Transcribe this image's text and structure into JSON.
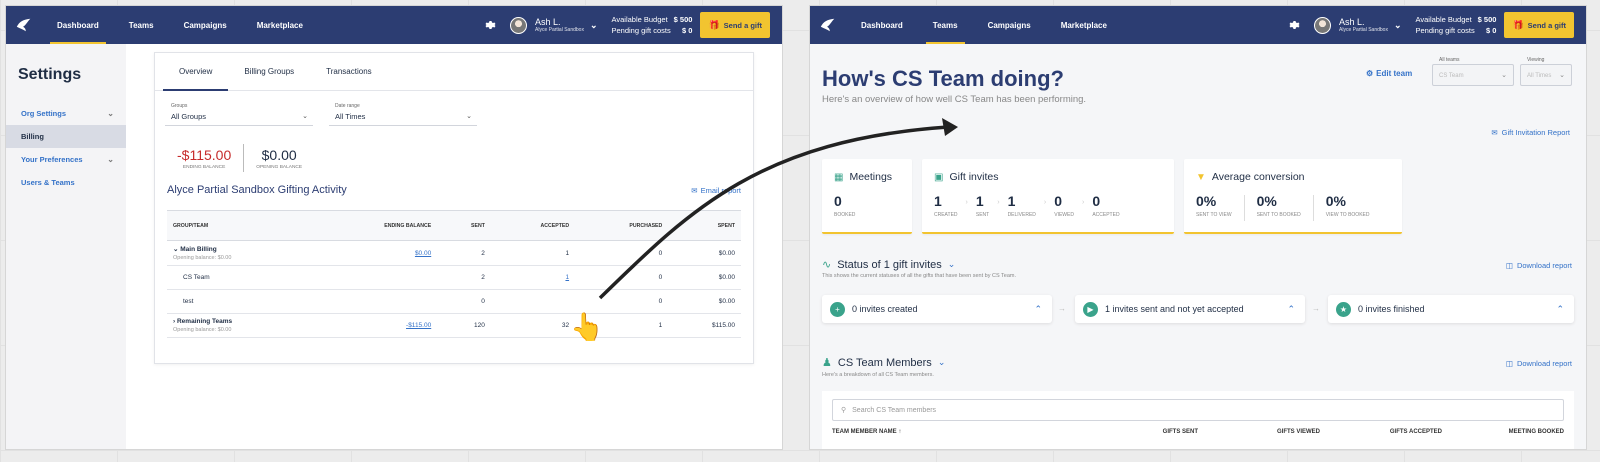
{
  "nav": {
    "items": [
      "Dashboard",
      "Teams",
      "Campaigns",
      "Marketplace"
    ],
    "user_name": "Ash L.",
    "user_sub": "Alyce Partial Sandbox",
    "budget_label": "Available Budget",
    "budget_value": "$ 500",
    "pending_label": "Pending gift costs",
    "pending_value": "$ 0",
    "send_gift": "Send a gift"
  },
  "left": {
    "sidebar": {
      "title": "Settings",
      "items": [
        {
          "label": "Org Settings"
        },
        {
          "label": "Billing"
        },
        {
          "label": "Your Preferences"
        },
        {
          "label": "Users & Teams"
        }
      ]
    },
    "tabs": [
      "Overview",
      "Billing Groups",
      "Transactions"
    ],
    "filters": {
      "groups_label": "Groups",
      "groups_value": "All Groups",
      "date_label": "Date range",
      "date_value": "All Times"
    },
    "balances": {
      "ending_value": "-$115.00",
      "ending_label": "ENDING BALANCE",
      "opening_value": "$0.00",
      "opening_label": "OPENING BALANCE"
    },
    "activity_title": "Alyce Partial Sandbox Gifting Activity",
    "email_report": "Email report",
    "table": {
      "headers": [
        "GROUP/TEAM",
        "ENDING BALANCE",
        "SENT",
        "ACCEPTED",
        "PURCHASED",
        "SPENT"
      ],
      "rows": [
        {
          "name": "Main Billing",
          "sub": "Opening balance: $0.00",
          "ending": "$0.00",
          "sent": "2",
          "accepted": "1",
          "purchased": "0",
          "spent": "$0.00"
        },
        {
          "name": "CS Team",
          "sub": "",
          "ending": "",
          "sent": "2",
          "accepted": "1",
          "purchased": "0",
          "spent": "$0.00"
        },
        {
          "name": "test",
          "sub": "",
          "ending": "",
          "sent": "0",
          "accepted": "",
          "purchased": "0",
          "spent": "$0.00"
        },
        {
          "name": "Remaining Teams",
          "sub": "Opening balance: $0.00",
          "ending": "-$115.00",
          "sent": "120",
          "accepted": "32",
          "purchased": "1",
          "spent": "$115.00"
        }
      ]
    }
  },
  "right": {
    "title": "How's CS Team doing?",
    "subtitle": "Here's an overview of how well CS Team has been performing.",
    "edit_team": "Edit team",
    "select_all_teams_label": "All teams",
    "select_all_teams_value": "CS Team",
    "select_viewing_label": "Viewing",
    "select_viewing_value": "All Times",
    "gift_invitation_report": "Gift Invitation Report",
    "meetings": {
      "title": "Meetings",
      "value": "0",
      "label": "BOOKED"
    },
    "gift_invites": {
      "title": "Gift invites",
      "values": [
        {
          "num": "1",
          "label": "CREATED"
        },
        {
          "num": "1",
          "label": "SENT"
        },
        {
          "num": "1",
          "label": "DELIVERED"
        },
        {
          "num": "0",
          "label": "VIEWED"
        },
        {
          "num": "0",
          "label": "ACCEPTED"
        }
      ]
    },
    "conversion": {
      "title": "Average conversion",
      "values": [
        {
          "num": "0%",
          "label": "SENT TO VIEW"
        },
        {
          "num": "0%",
          "label": "SENT TO BOOKED"
        },
        {
          "num": "0%",
          "label": "VIEW TO BOOKED"
        }
      ]
    },
    "status": {
      "title": "Status of 1 gift invites",
      "sub": "This shows the current statuses of all the gifts that have been sent by CS Team.",
      "download": "Download report",
      "steps": [
        "0 invites created",
        "1 invites sent and not yet accepted",
        "0 invites finished"
      ]
    },
    "members": {
      "title": "CS Team Members",
      "sub": "Here's a breakdown of all CS Team members.",
      "download": "Download report",
      "search_placeholder": "Search CS Team members",
      "columns": [
        "TEAM MEMBER NAME",
        "GIFTS SENT",
        "GIFTS VIEWED",
        "GIFTS ACCEPTED",
        "MEETING BOOKED"
      ]
    }
  },
  "colors": {
    "nav": "#2c3d72",
    "accent": "#f2c430",
    "link": "#3472c8",
    "negative": "#c62b2b"
  }
}
